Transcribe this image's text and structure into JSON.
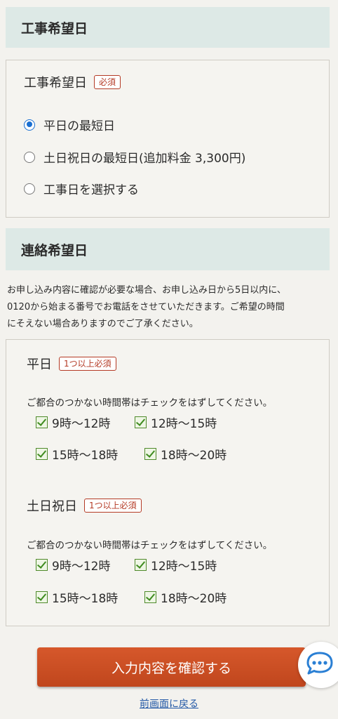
{
  "section1": {
    "header": "工事希望日",
    "field_label": "工事希望日",
    "badge": "必須",
    "options": [
      {
        "label": "平日の最短日",
        "checked": true
      },
      {
        "label": "土日祝日の最短日(追加料金 3,300円)",
        "checked": false
      },
      {
        "label": "工事日を選択する",
        "checked": false
      }
    ]
  },
  "section2": {
    "header": "連絡希望日",
    "notice": [
      "お申し込み内容に確認が必要な場合、お申し込み日から5日以内に、",
      "0120から始まる番号でお電話をさせていただきます。ご希望の時間",
      "にそえない場合ありますのでご了承ください。"
    ],
    "weekday": {
      "label": "平日",
      "badge": "1つ以上必須",
      "hint": "ご都合のつかない時間帯はチェックをはずしてください。",
      "slots": [
        "9時〜12時",
        "12時〜15時",
        "15時〜18時",
        "18時〜20時"
      ]
    },
    "weekend": {
      "label": "土日祝日",
      "badge": "1つ以上必須",
      "hint": "ご都合のつかない時間帯はチェックをはずしてください。",
      "slots": [
        "9時〜12時",
        "12時〜15時",
        "15時〜18時",
        "18時〜20時"
      ]
    }
  },
  "actions": {
    "submit": "入力内容を確認する",
    "back": "前画面に戻る"
  },
  "colors": {
    "accent": "#c8502a",
    "header_bg": "#dde9e6",
    "check": "#3f8b1f",
    "radio": "#1a6fd1"
  },
  "icons": {
    "chat": "chat-bubble-icon"
  }
}
